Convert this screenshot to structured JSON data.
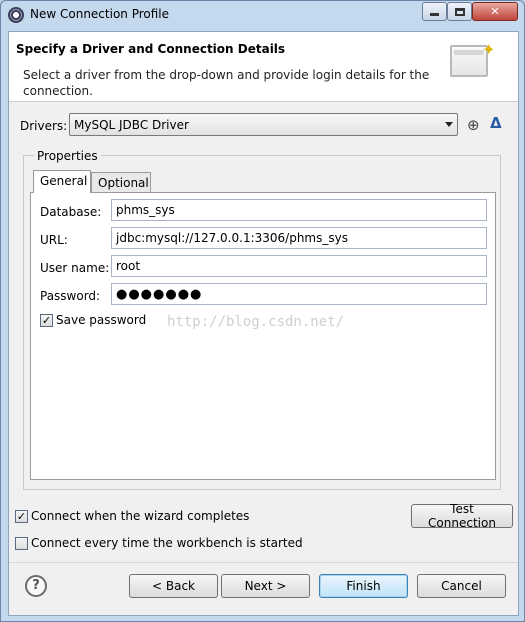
{
  "window": {
    "title": "New Connection Profile"
  },
  "header": {
    "title": "Specify a Driver and Connection Details",
    "description": "Select a driver from the drop-down and provide login details for the connection."
  },
  "drivers": {
    "label": "Drivers:",
    "selected": "MySQL JDBC Driver"
  },
  "properties": {
    "legend": "Properties",
    "tabs": [
      {
        "label": "General",
        "active": true
      },
      {
        "label": "Optional",
        "active": false
      }
    ],
    "fields": {
      "database_label": "Database:",
      "database_value": "phms_sys",
      "url_label": "URL:",
      "url_value": "jdbc:mysql://127.0.0.1:3306/phms_sys",
      "username_label": "User name:",
      "username_value": "root",
      "password_label": "Password:",
      "password_value": "●●●●●●●"
    },
    "save_password": {
      "label": "Save password",
      "checked": true
    },
    "watermark": "http://blog.csdn.net/"
  },
  "options": {
    "connect_on_complete": {
      "label": "Connect when the wizard completes",
      "checked": true
    },
    "connect_every_time": {
      "label": "Connect every time the workbench is started",
      "checked": false
    }
  },
  "buttons": {
    "test_connection": "Test Connection",
    "back": "< Back",
    "next": "Next >",
    "finish": "Finish",
    "cancel": "Cancel"
  },
  "icons": {
    "app": "eclipse-icon",
    "help": "help-icon",
    "new_driver": "new-driver-icon",
    "edit_driver": "edit-driver-icon"
  }
}
